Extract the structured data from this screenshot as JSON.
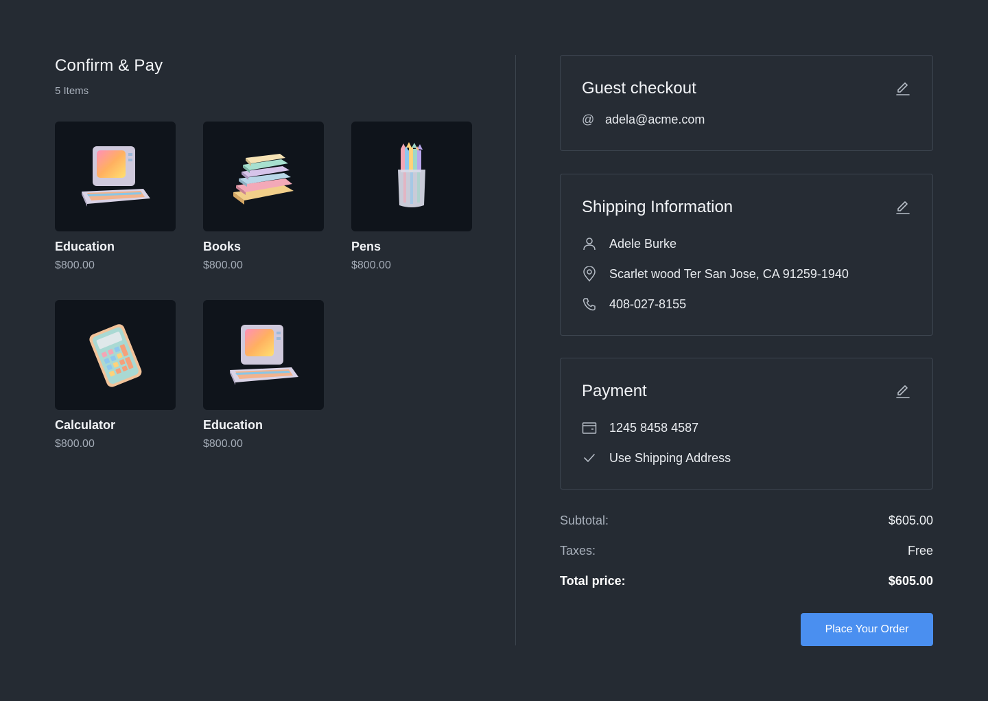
{
  "header": {
    "title": "Confirm & Pay",
    "item_count": "5 Items"
  },
  "products": [
    {
      "name": "Education",
      "price": "$800.00",
      "icon": "retro-computer-icon"
    },
    {
      "name": "Books",
      "price": "$800.00",
      "icon": "book-stack-icon"
    },
    {
      "name": "Pens",
      "price": "$800.00",
      "icon": "pencil-cup-icon"
    },
    {
      "name": "Calculator",
      "price": "$800.00",
      "icon": "calculator-icon"
    },
    {
      "name": "Education",
      "price": "$800.00",
      "icon": "retro-computer-icon"
    }
  ],
  "guest": {
    "title": "Guest checkout",
    "email": "adela@acme.com",
    "at_symbol": "@"
  },
  "shipping": {
    "title": "Shipping Information",
    "name": "Adele Burke",
    "address": "Scarlet wood Ter San Jose, CA 91259-1940",
    "phone": "408-027-8155"
  },
  "payment": {
    "title": "Payment",
    "card_number": "1245 8458 4587",
    "billing_note": "Use Shipping Address"
  },
  "summary": {
    "subtotal_label": "Subtotal:",
    "subtotal_value": "$605.00",
    "taxes_label": "Taxes:",
    "taxes_value": "Free",
    "total_label": "Total price:",
    "total_value": "$605.00"
  },
  "order_button": "Place Your Order",
  "colors": {
    "background": "#252b33",
    "accent": "#4a8ff0",
    "thumb_bg": "#0f141b"
  }
}
